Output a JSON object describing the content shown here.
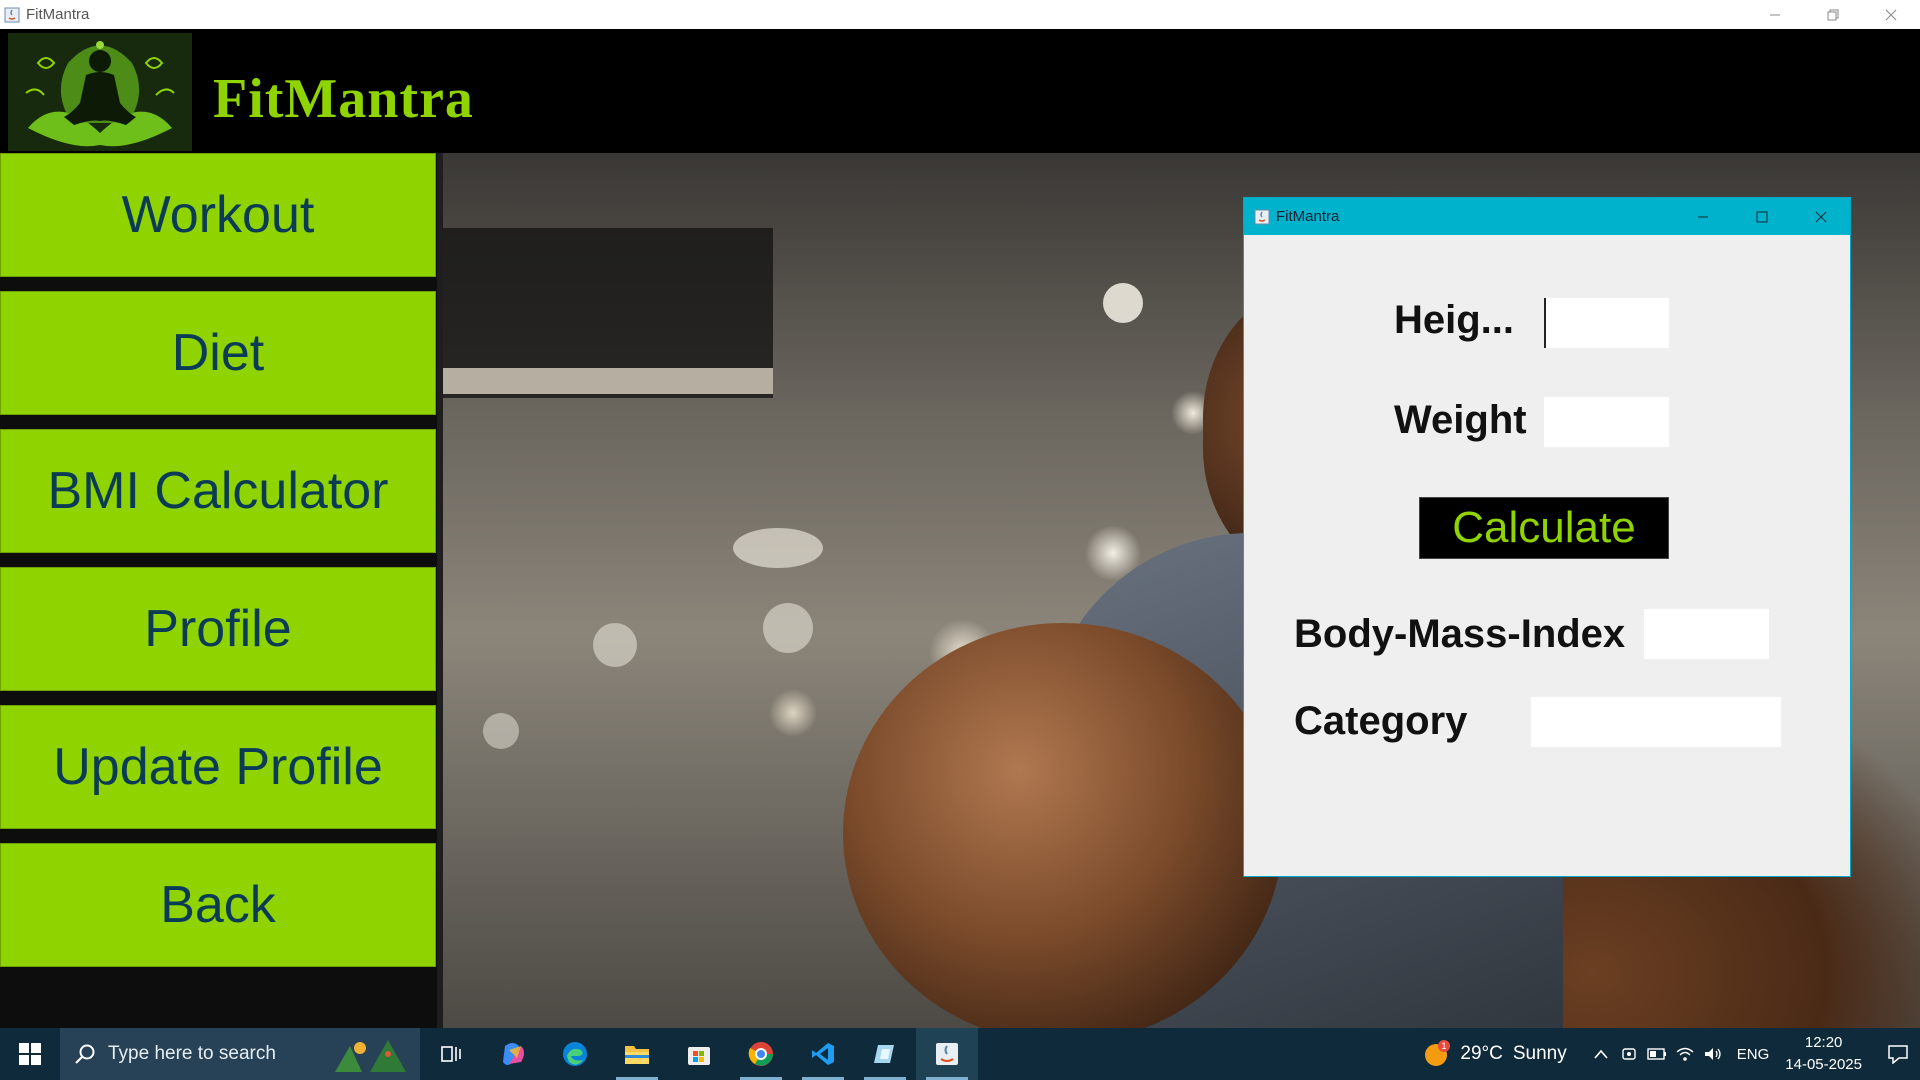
{
  "window": {
    "title": "FitMantra",
    "controls": {
      "minimize": "minimize",
      "restore": "restore",
      "close": "close"
    }
  },
  "header": {
    "brand": "FitMantra"
  },
  "sidebar": {
    "items": [
      {
        "label": "Workout"
      },
      {
        "label": "Diet"
      },
      {
        "label": "BMI Calculator"
      },
      {
        "label": "Profile"
      },
      {
        "label": "Update Profile"
      },
      {
        "label": "Back"
      }
    ]
  },
  "dialog": {
    "title": "FitMantra",
    "height_label": "Heig...",
    "height_value": "",
    "weight_label": "Weight",
    "weight_value": "",
    "calculate_label": "Calculate",
    "bmi_label": "Body-Mass-Index",
    "bmi_value": "",
    "category_label": "Category",
    "category_value": ""
  },
  "taskbar": {
    "search_placeholder": "Type here to search",
    "weather": {
      "temp": "29°C",
      "condition": "Sunny",
      "badge": "1"
    },
    "language": "ENG",
    "time": "12:20",
    "date": "14-05-2025",
    "pinned_icons": [
      "task-view-icon",
      "copilot-icon",
      "edge-icon",
      "file-explorer-icon",
      "store-icon",
      "chrome-icon",
      "vscode-icon",
      "app-icon",
      "java-icon"
    ]
  },
  "colors": {
    "accent_green": "#8fd400",
    "nav_text": "#0b3b55",
    "dialog_titlebar": "#00b2cc",
    "taskbar": "#0f2a3a"
  }
}
